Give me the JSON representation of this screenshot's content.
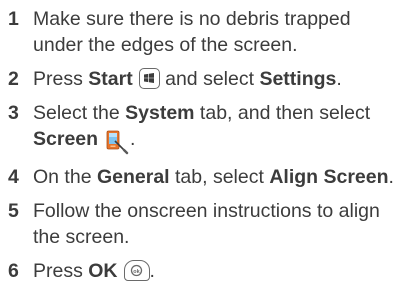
{
  "steps": [
    {
      "number": "1",
      "text": "Make sure there is no debris trapped under the edges of the screen."
    },
    {
      "number": "2",
      "pre": "Press ",
      "bold1": "Start",
      "mid": " and select ",
      "bold2": "Settings",
      "post": "."
    },
    {
      "number": "3",
      "pre": "Select the ",
      "bold1": "System",
      "mid": " tab, and then select ",
      "bold2": "Screen",
      "post": "."
    },
    {
      "number": "4",
      "pre": "On the ",
      "bold1": "General",
      "mid": " tab, select ",
      "bold2": "Align Screen",
      "post": "."
    },
    {
      "number": "5",
      "text": "Follow the onscreen instructions to align the screen."
    },
    {
      "number": "6",
      "pre": "Press ",
      "bold1": "OK",
      "post": "."
    }
  ],
  "icons": {
    "start": "windows-start-key-icon",
    "screen": "screen-settings-icon",
    "ok": "ok-key-icon"
  }
}
